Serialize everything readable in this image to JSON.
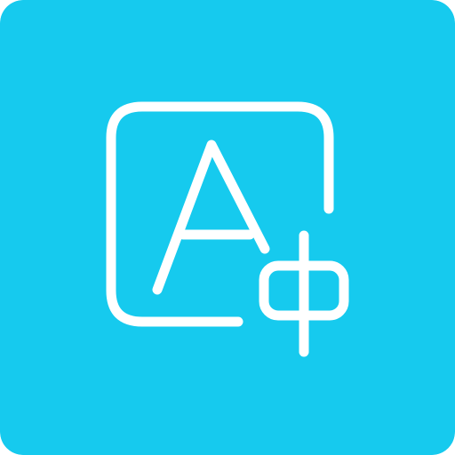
{
  "app_icon": {
    "name": "translate-icon",
    "background_color": "#16CAEE",
    "foreground_color": "#FFFFFF",
    "glyphs": [
      "A",
      "ф"
    ]
  }
}
